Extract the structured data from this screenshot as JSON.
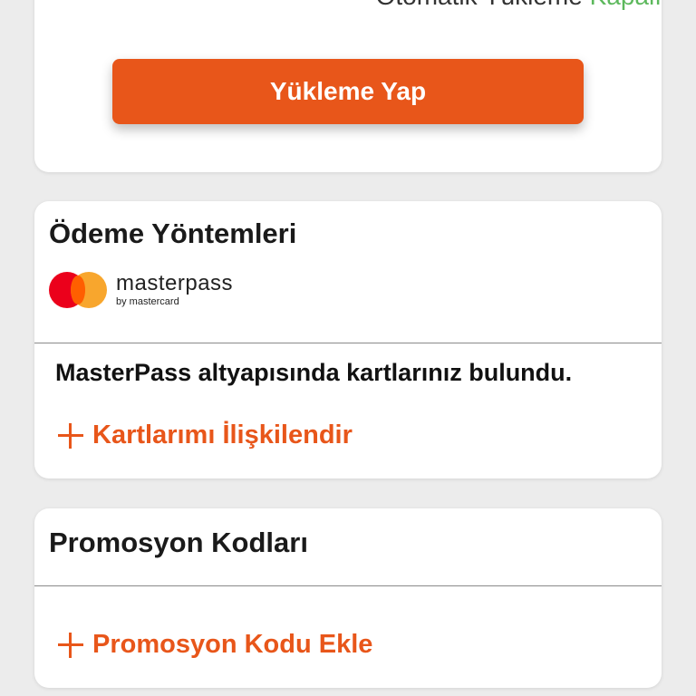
{
  "top_card": {
    "auto_load_label": "Otomatik Yükleme",
    "auto_load_status": "Kapalı",
    "topup_button_label": "Yükleme Yap"
  },
  "payment_methods": {
    "title": "Ödeme Yöntemleri",
    "masterpass_logo": {
      "word": "masterpass",
      "byline": "by mastercard"
    },
    "found_message": "MasterPass altyapısında kartlarınız bulundu.",
    "link_cards_label": "Kartlarımı İlişkilendir"
  },
  "promo_codes": {
    "title": "Promosyon Kodları",
    "add_promo_label": "Promosyon Kodu Ekle"
  },
  "colors": {
    "accent": "#e8561a",
    "status_off": "#5cb85c",
    "background": "#ececec"
  },
  "icons": [
    "plus-icon",
    "mastercard-logo-icon"
  ]
}
